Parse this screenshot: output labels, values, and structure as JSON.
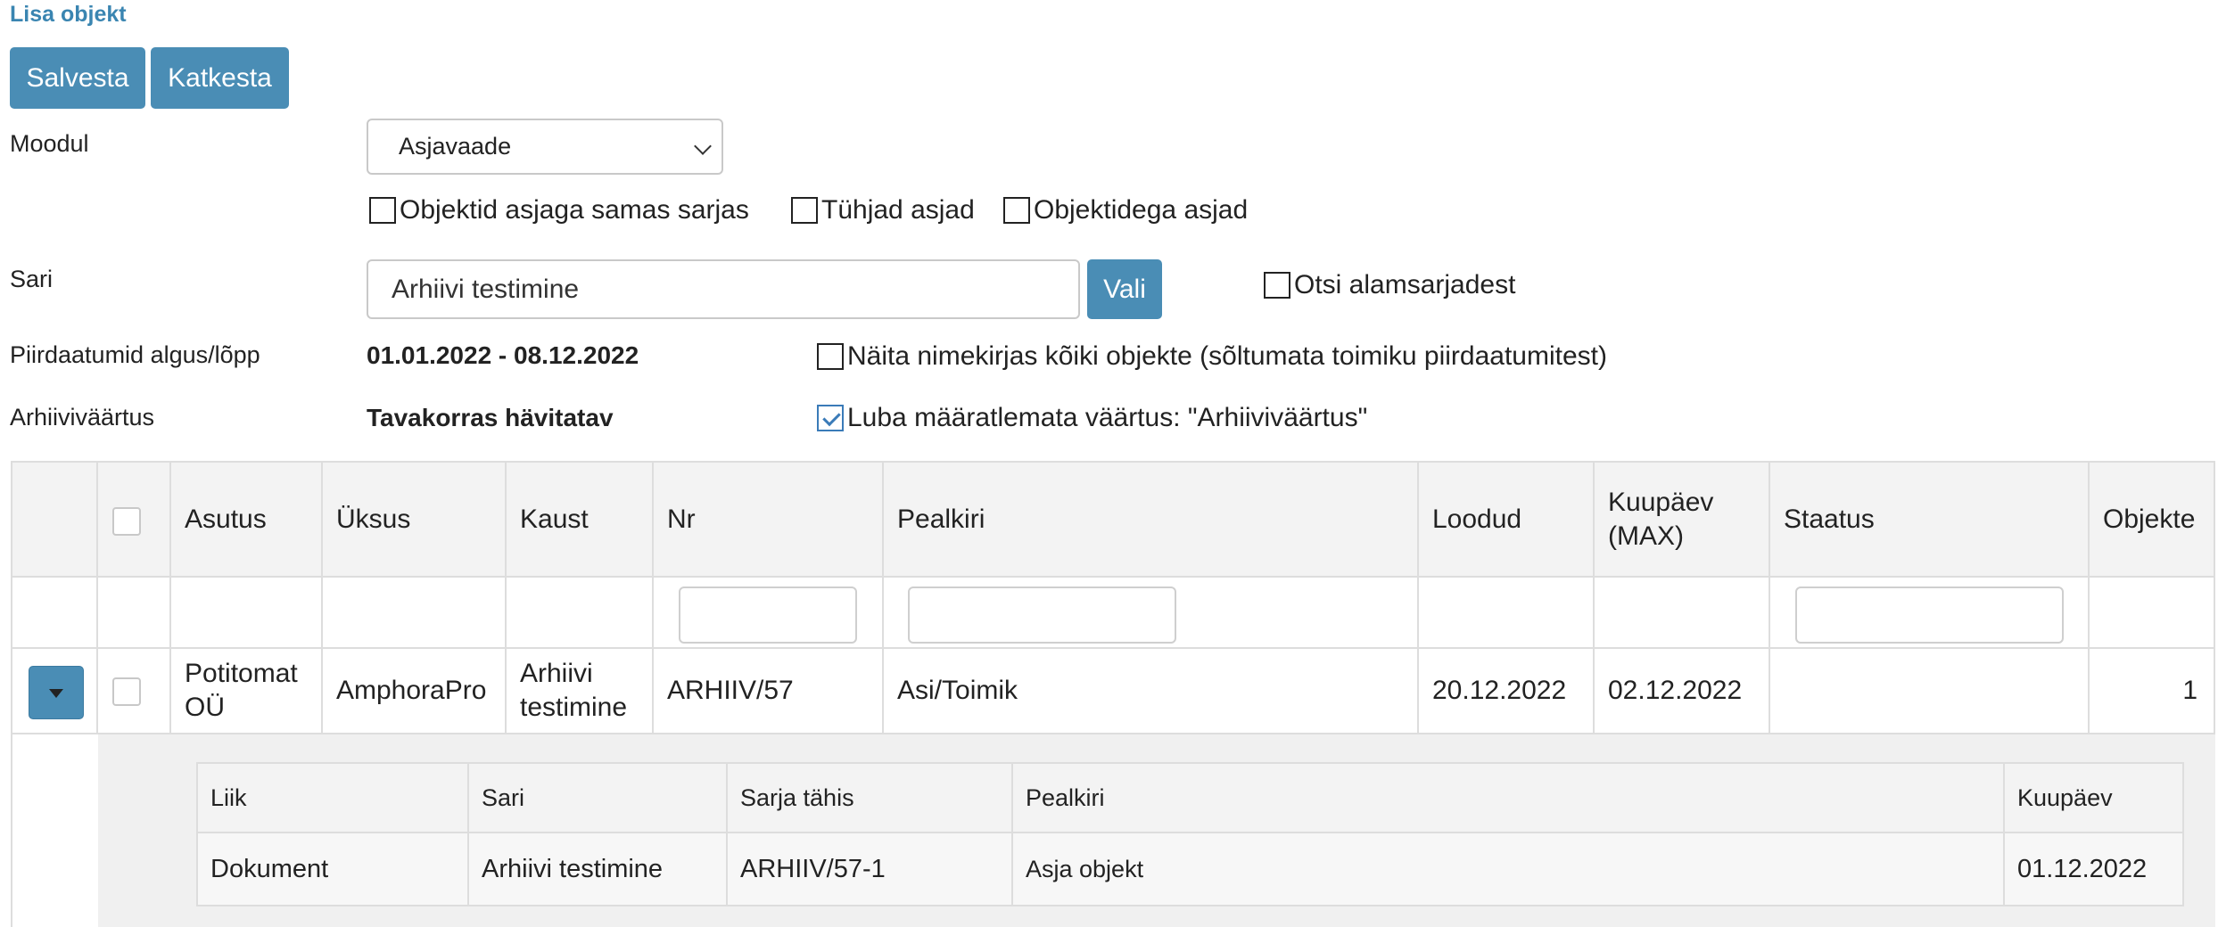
{
  "page": {
    "title": "Lisa objekt",
    "save_label": "Salvesta",
    "cancel_label": "Katkesta"
  },
  "form": {
    "module_label": "Moodul",
    "module_value": "Asjavaade",
    "options": {
      "same_series": "Objektid asjaga samas sarjas",
      "empty_cases": "Tühjad asjad",
      "cases_with_objects": "Objektidega asjad"
    },
    "series_label": "Sari",
    "series_value": "Arhiivi testimine",
    "choose_label": "Vali",
    "search_subseries": "Otsi alamsarjadest",
    "dates_label": "Piirdaatumid algus/lõpp",
    "dates_value": "01.01.2022 - 08.12.2022",
    "show_all": "Näita nimekirjas kõiki objekte (sõltumata toimiku piirdaatumitest)",
    "archive_value_label": "Arhiiviväärtus",
    "archive_value": "Tavakorras hävitatav",
    "allow_undefined": "Luba määratlemata väärtus: \"Arhiiviväärtus\"",
    "allow_undefined_checked": true
  },
  "grid": {
    "headers": {
      "asutus": "Asutus",
      "uksus": "Üksus",
      "kaust": "Kaust",
      "nr": "Nr",
      "pealkiri": "Pealkiri",
      "loodud": "Loodud",
      "kuupaev_1": "Kuupäev",
      "kuupaev_2": "(MAX)",
      "staatus": "Staatus",
      "objekte": "Objekte"
    },
    "row": {
      "asutus_1": "Potitomat",
      "asutus_2": "OÜ",
      "uksus": "AmphoraPro",
      "kaust_1": "Arhiivi",
      "kaust_2": "testimine",
      "nr": "ARHIIV/57",
      "pealkiri": "Asi/Toimik",
      "loodud": "20.12.2022",
      "kuupaev": "02.12.2022",
      "staatus": "",
      "objekte": "1"
    }
  },
  "subgrid": {
    "headers": {
      "liik": "Liik",
      "sari": "Sari",
      "sarja_tahis": "Sarja tähis",
      "pealkiri": "Pealkiri",
      "kuupaev": "Kuupäev"
    },
    "row": {
      "liik": "Dokument",
      "sari": "Arhiivi testimine",
      "sarja_tahis": "ARHIIV/57-1",
      "pealkiri": "Asja objekt",
      "kuupaev": "01.12.2022"
    }
  },
  "colors": {
    "accent": "#4a8db5",
    "title": "#3a85b1",
    "header_bg": "#f3f3f3",
    "border": "#dddddd"
  }
}
